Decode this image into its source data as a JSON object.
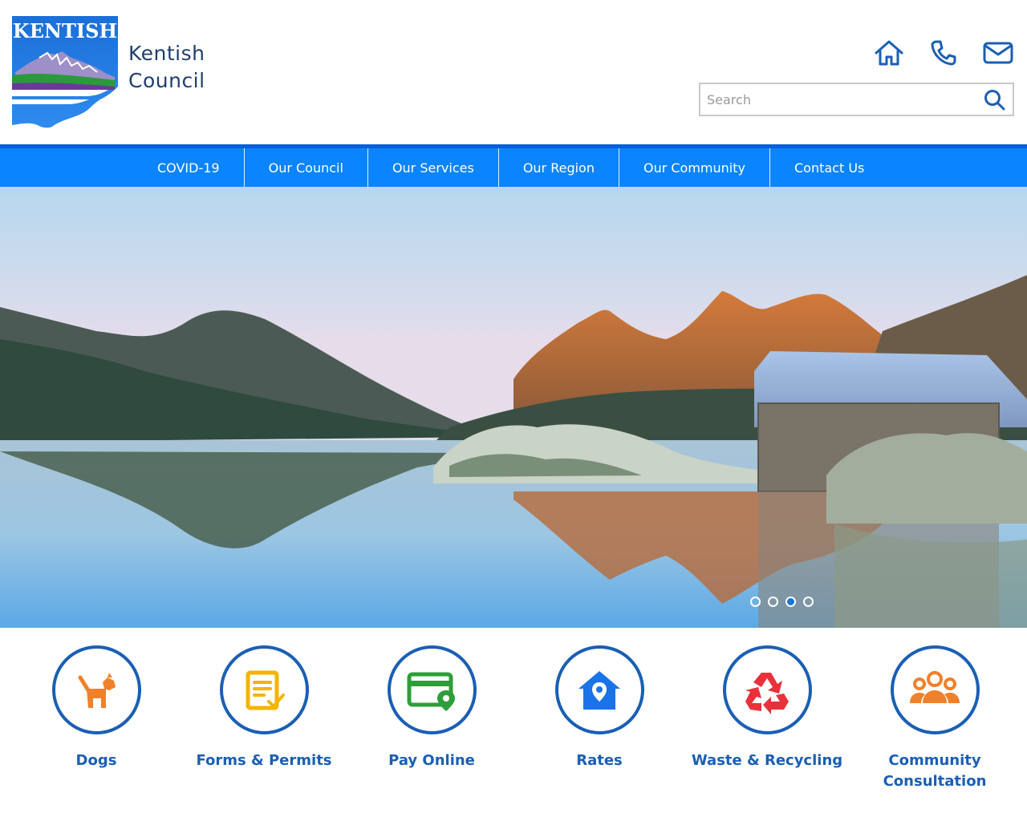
{
  "header": {
    "logo_text": "KENTISH",
    "brand_line1": "Kentish",
    "brand_line2": "Council",
    "icons": [
      "home-icon",
      "phone-icon",
      "mail-icon"
    ]
  },
  "search": {
    "placeholder": "Search",
    "value": ""
  },
  "nav": {
    "items": [
      {
        "label": "COVID-19"
      },
      {
        "label": "Our Council"
      },
      {
        "label": "Our Services"
      },
      {
        "label": "Our Region"
      },
      {
        "label": "Our Community"
      },
      {
        "label": "Contact Us"
      }
    ]
  },
  "hero": {
    "slide_count": 4,
    "active_slide": 3
  },
  "quick_links": [
    {
      "label": "Dogs",
      "icon": "dog-icon",
      "color": "#f0812a"
    },
    {
      "label": "Forms & Permits",
      "icon": "form-icon",
      "color": "#f4b400"
    },
    {
      "label": "Pay Online",
      "icon": "card-location-icon",
      "color": "#2e9e3a"
    },
    {
      "label": "Rates",
      "icon": "house-location-icon",
      "color": "#1a73e8"
    },
    {
      "label": "Waste & Recycling",
      "icon": "recycle-icon",
      "color": "#e8313b"
    },
    {
      "label": "Community Consultation",
      "icon": "people-icon",
      "color": "#f0812a"
    }
  ],
  "colors": {
    "nav_bg": "#0a84ff",
    "nav_strip": "#0b5fd6",
    "brand_text": "#1f3f6e",
    "quick_link": "#1a5fb4"
  }
}
